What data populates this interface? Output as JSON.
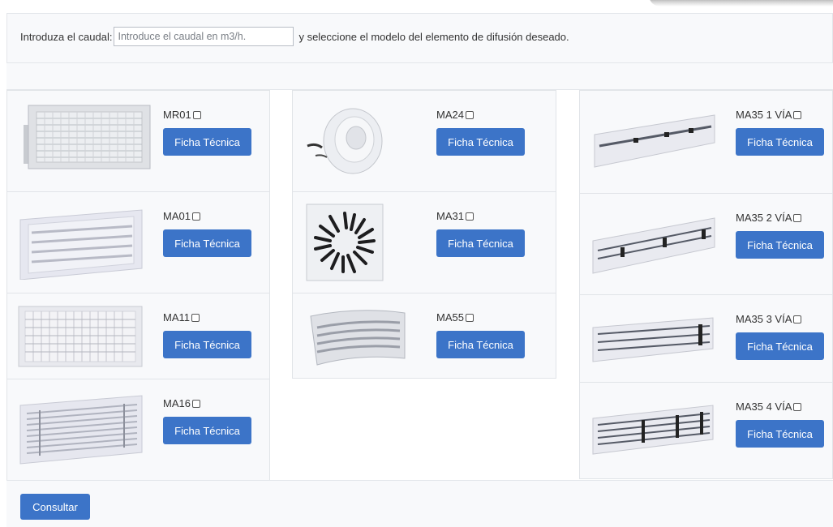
{
  "header": {
    "label_before": "Introduza el caudal:",
    "input_placeholder": "Introduce el caudal en m3/h.",
    "input_value": "",
    "label_after": "y seleccione el modelo del elemento de difusión deseado."
  },
  "products": {
    "col1": [
      {
        "model": "MR01",
        "button": "Ficha Técnica",
        "checked": false,
        "image": "grille-double-deflection-with-damper"
      },
      {
        "model": "MA01",
        "button": "Ficha Técnica",
        "checked": false,
        "image": "grille-single-deflection"
      },
      {
        "model": "MA11",
        "button": "Ficha Técnica",
        "checked": false,
        "image": "grille-double-deflection"
      },
      {
        "model": "MA16",
        "button": "Ficha Técnica",
        "checked": false,
        "image": "grille-linear-bar"
      }
    ],
    "col2": [
      {
        "model": "MA24",
        "button": "Ficha Técnica",
        "checked": false,
        "image": "round-jet-nozzle"
      },
      {
        "model": "MA31",
        "button": "Ficha Técnica",
        "checked": false,
        "image": "swirl-diffuser"
      },
      {
        "model": "MA55",
        "button": "Ficha Técnica",
        "checked": false,
        "image": "curved-grille"
      }
    ],
    "col3": [
      {
        "model": "MA35 1 VÍA",
        "button": "Ficha Técnica",
        "checked": false,
        "image": "linear-slot-1-way"
      },
      {
        "model": "MA35 2 VÍA",
        "button": "Ficha Técnica",
        "checked": false,
        "image": "linear-slot-2-way"
      },
      {
        "model": "MA35 3 VÍA",
        "button": "Ficha Técnica",
        "checked": false,
        "image": "linear-slot-3-way"
      },
      {
        "model": "MA35 4 VÍA",
        "button": "Ficha Técnica",
        "checked": false,
        "image": "linear-slot-4-way"
      }
    ]
  },
  "footer": {
    "submit_label": "Consultar"
  },
  "colors": {
    "button": "#3c74c8",
    "card_bg": "#f8f9fb",
    "border": "#e1e4e8"
  }
}
